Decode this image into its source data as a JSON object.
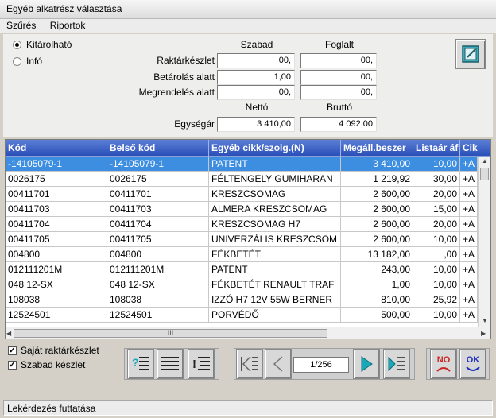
{
  "window": {
    "title": "Egyéb alkatrész választása"
  },
  "menu": [
    "Szűrés",
    "Riportok"
  ],
  "mode": {
    "options": [
      "Kitárolható",
      "Infó"
    ],
    "selected": "Kitárolható"
  },
  "stock": {
    "col_free": "Szabad",
    "col_reserved": "Foglalt",
    "rows": [
      {
        "label": "Raktárkészlet",
        "free": "00,",
        "reserved": "00,"
      },
      {
        "label": "Betárolás alatt",
        "free": "1,00",
        "reserved": "00,"
      },
      {
        "label": "Megrendelés alatt",
        "free": "00,",
        "reserved": "00,"
      }
    ],
    "col_net": "Nettó",
    "col_gross": "Bruttó",
    "unit_price_label": "Egységár",
    "unit_price_net": "3 410,00",
    "unit_price_gross": "4 092,00"
  },
  "grid": {
    "columns": [
      "Kód",
      "Belső kód",
      "Egyéb cikk/szolg.(N)",
      "Megáll.beszer",
      "Listaár áf",
      "Cik"
    ],
    "rows": [
      {
        "kod": "-14105079-1",
        "belso": "-14105079-1",
        "nev": "PATENT",
        "ar": "3 410,00",
        "lista": "10,00",
        "cik": "+A",
        "selected": true
      },
      {
        "kod": "0026175",
        "belso": "0026175",
        "nev": "FÉLTENGELY GUMIHARAN",
        "ar": "1 219,92",
        "lista": "30,00",
        "cik": "+A"
      },
      {
        "kod": "00411701",
        "belso": "00411701",
        "nev": "KRESZCSOMAG",
        "ar": "2 600,00",
        "lista": "20,00",
        "cik": "+A"
      },
      {
        "kod": "00411703",
        "belso": "00411703",
        "nev": "ALMERA KRESZCSOMAG",
        "ar": "2 600,00",
        "lista": "15,00",
        "cik": "+A"
      },
      {
        "kod": "00411704",
        "belso": "00411704",
        "nev": "KRESZCSOMAG H7",
        "ar": "2 600,00",
        "lista": "20,00",
        "cik": "+A"
      },
      {
        "kod": "00411705",
        "belso": "00411705",
        "nev": "UNIVERZÁLIS KRESZCSOM",
        "ar": "2 600,00",
        "lista": "10,00",
        "cik": "+A"
      },
      {
        "kod": "004800",
        "belso": "004800",
        "nev": "FÉKBETÉT",
        "ar": "13 182,00",
        "lista": ",00",
        "cik": "+A"
      },
      {
        "kod": "012111201M",
        "belso": "012111201M",
        "nev": "PATENT",
        "ar": "243,00",
        "lista": "10,00",
        "cik": "+A"
      },
      {
        "kod": "048 12-SX",
        "belso": "048 12-SX",
        "nev": "FÉKBETÉT RENAULT TRAF",
        "ar": "1,00",
        "lista": "10,00",
        "cik": "+A"
      },
      {
        "kod": "108038",
        "belso": "108038",
        "nev": "IZZÓ H7 12V 55W BERNER",
        "ar": "810,00",
        "lista": "25,92",
        "cik": "+A"
      },
      {
        "kod": "12524501",
        "belso": "12524501",
        "nev": "PORVÉDŐ",
        "ar": "500,00",
        "lista": "10,00",
        "cik": "+A"
      }
    ],
    "hscroll_grip": "III"
  },
  "filters": [
    {
      "label": "Saját raktárkészlet",
      "checked": true
    },
    {
      "label": "Szabad készlet",
      "checked": true
    }
  ],
  "pager": {
    "page": "1/256"
  },
  "actions": {
    "no_label": "NO",
    "ok_label": "OK"
  },
  "status": {
    "text": "Lekérdezés futtatása"
  },
  "colors": {
    "header": "#2a4fb8",
    "selection": "#3d8ee0",
    "nav_accent": "#1aa8b8",
    "no": "#cc2222",
    "ok": "#2233bb"
  }
}
